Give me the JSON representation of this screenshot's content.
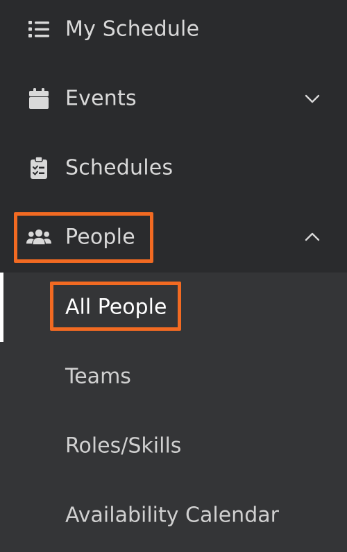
{
  "nav": {
    "items": [
      {
        "label": "My Schedule",
        "icon": "list-icon"
      },
      {
        "label": "Events",
        "icon": "calendar-icon",
        "expandable": true,
        "expanded": false
      },
      {
        "label": "Schedules",
        "icon": "clipboard-check-icon"
      },
      {
        "label": "People",
        "icon": "users-icon",
        "expandable": true,
        "expanded": true
      }
    ],
    "people_subitems": [
      {
        "label": "All People",
        "active": true
      },
      {
        "label": "Teams"
      },
      {
        "label": "Roles/Skills"
      },
      {
        "label": "Availability Calendar"
      }
    ]
  },
  "colors": {
    "sidebar_bg": "#2a2b2d",
    "submenu_bg": "#343537",
    "text": "#d9d9d9",
    "highlight": "#f26a22",
    "active_indicator": "#ffffff"
  }
}
